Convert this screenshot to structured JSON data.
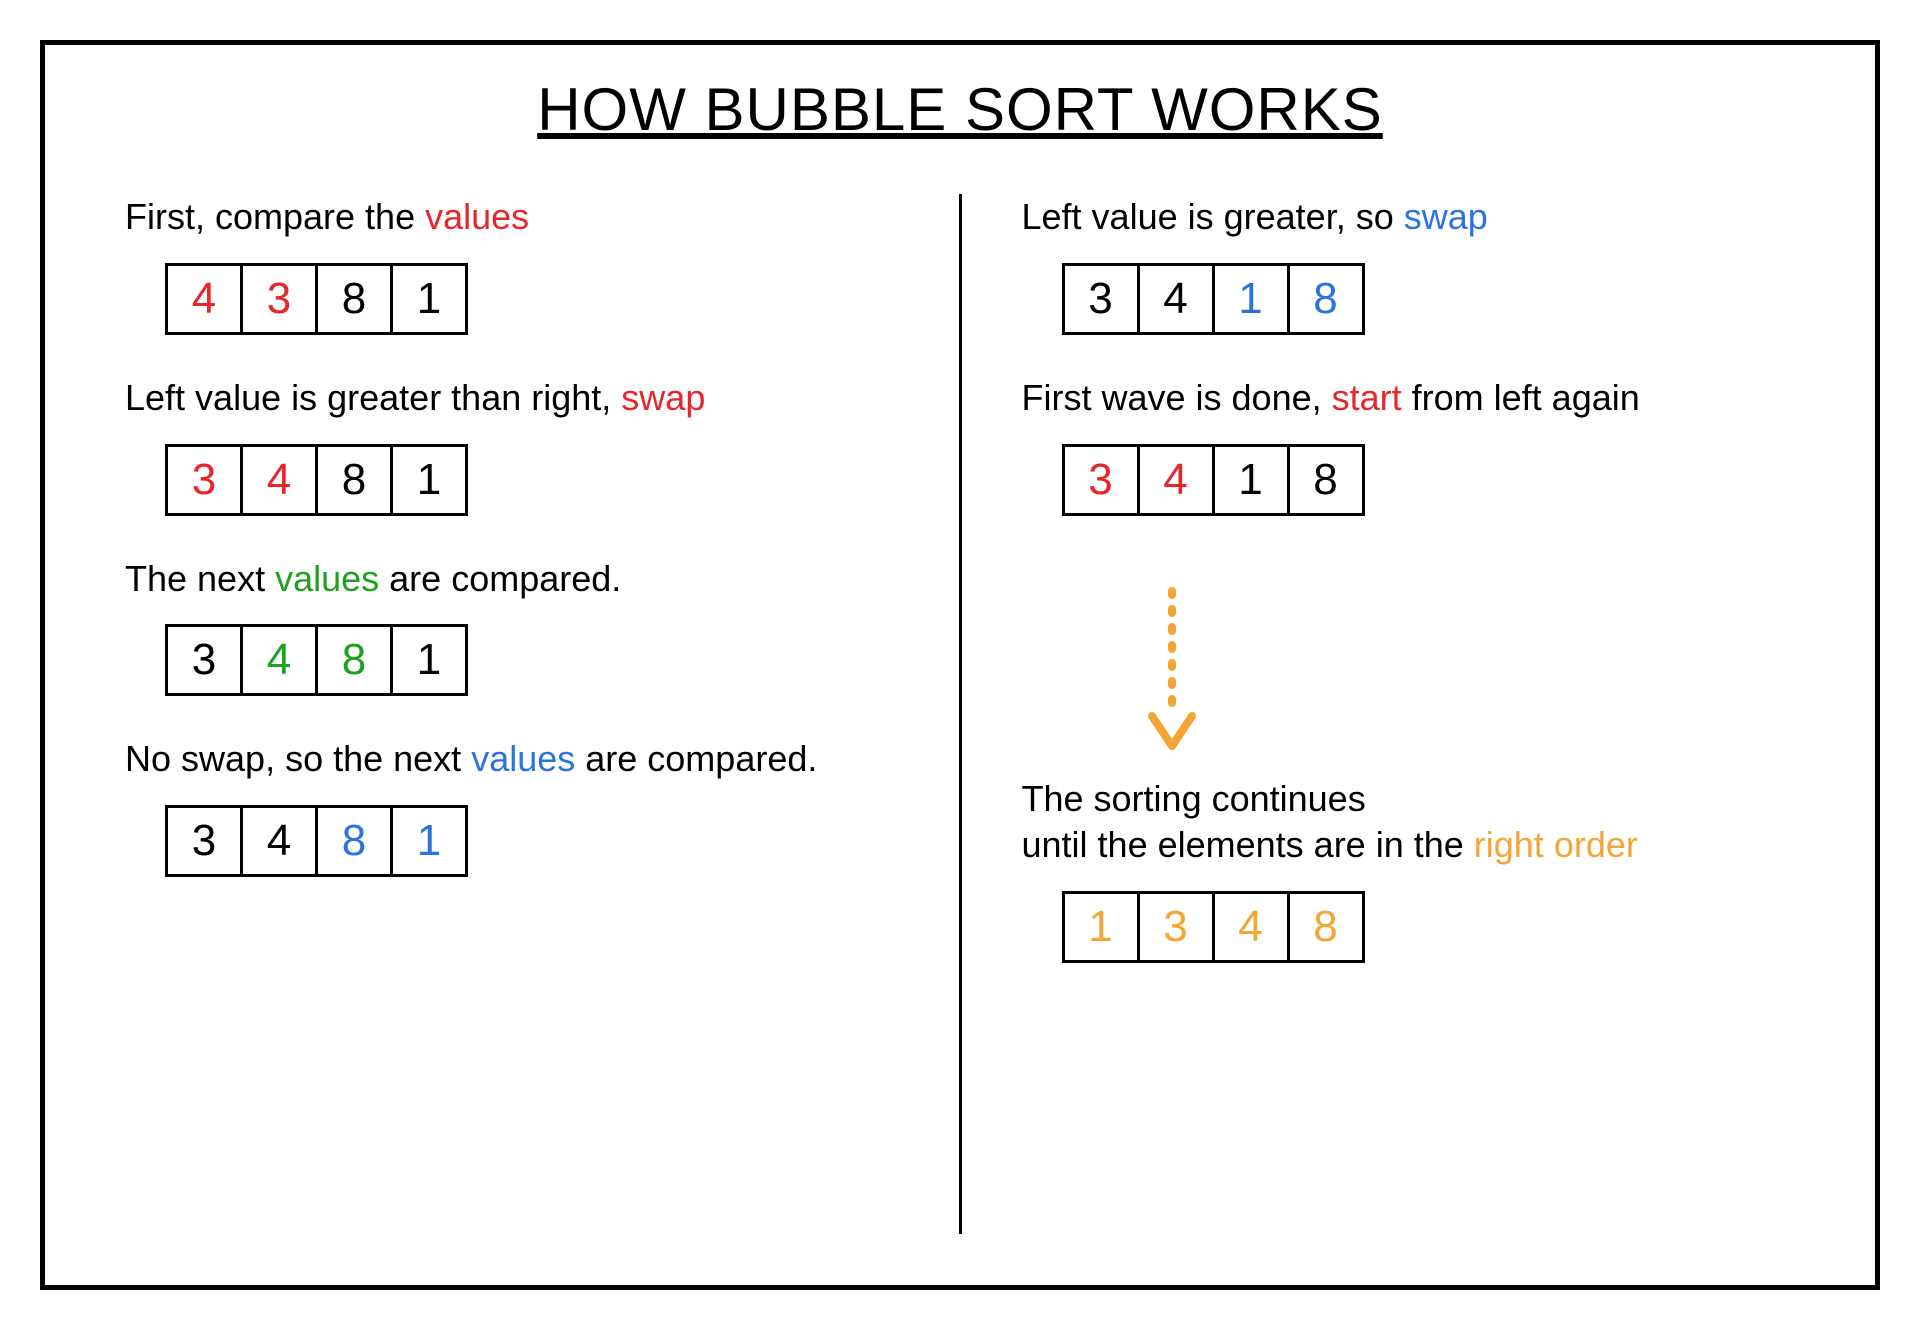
{
  "title": "HOW BUBBLE SORT WORKS",
  "colors": {
    "red": "#e6262a",
    "green": "#1fa01f",
    "blue": "#2a73e0",
    "orange": "#f4a536",
    "black": "#000000"
  },
  "left": [
    {
      "caption": [
        {
          "text": "First, compare the ",
          "color": "black"
        },
        {
          "text": "values",
          "color": "red"
        }
      ],
      "cells": [
        {
          "v": "4",
          "color": "red"
        },
        {
          "v": "3",
          "color": "red"
        },
        {
          "v": "8",
          "color": "black"
        },
        {
          "v": "1",
          "color": "black"
        }
      ]
    },
    {
      "caption": [
        {
          "text": "Left value is greater than right, ",
          "color": "black"
        },
        {
          "text": "swap",
          "color": "red"
        }
      ],
      "cells": [
        {
          "v": "3",
          "color": "red"
        },
        {
          "v": "4",
          "color": "red"
        },
        {
          "v": "8",
          "color": "black"
        },
        {
          "v": "1",
          "color": "black"
        }
      ]
    },
    {
      "caption": [
        {
          "text": "The next ",
          "color": "black"
        },
        {
          "text": "values",
          "color": "green"
        },
        {
          "text": " are compared.",
          "color": "black"
        }
      ],
      "cells": [
        {
          "v": "3",
          "color": "black"
        },
        {
          "v": "4",
          "color": "green"
        },
        {
          "v": "8",
          "color": "green"
        },
        {
          "v": "1",
          "color": "black"
        }
      ]
    },
    {
      "caption": [
        {
          "text": "No swap, so the next ",
          "color": "black"
        },
        {
          "text": "values",
          "color": "blue"
        },
        {
          "text": " are compared.",
          "color": "black"
        }
      ],
      "cells": [
        {
          "v": "3",
          "color": "black"
        },
        {
          "v": "4",
          "color": "black"
        },
        {
          "v": "8",
          "color": "blue"
        },
        {
          "v": "1",
          "color": "blue"
        }
      ]
    }
  ],
  "right": [
    {
      "caption": [
        {
          "text": "Left value is greater, so ",
          "color": "black"
        },
        {
          "text": "swap",
          "color": "blue"
        }
      ],
      "cells": [
        {
          "v": "3",
          "color": "black"
        },
        {
          "v": "4",
          "color": "black"
        },
        {
          "v": "1",
          "color": "blue"
        },
        {
          "v": "8",
          "color": "blue"
        }
      ]
    },
    {
      "caption": [
        {
          "text": "First wave is done, ",
          "color": "black"
        },
        {
          "text": "start",
          "color": "red"
        },
        {
          "text": " from left again",
          "color": "black"
        }
      ],
      "cells": [
        {
          "v": "3",
          "color": "red"
        },
        {
          "v": "4",
          "color": "red"
        },
        {
          "v": "1",
          "color": "black"
        },
        {
          "v": "8",
          "color": "black"
        }
      ]
    },
    {
      "caption": [
        {
          "text": "The sorting continues\nuntil the elements are in the ",
          "color": "black"
        },
        {
          "text": "right order",
          "color": "orange"
        }
      ],
      "cells": [
        {
          "v": "1",
          "color": "orange"
        },
        {
          "v": "3",
          "color": "orange"
        },
        {
          "v": "4",
          "color": "orange"
        },
        {
          "v": "8",
          "color": "orange"
        }
      ],
      "arrow_before": true
    }
  ]
}
